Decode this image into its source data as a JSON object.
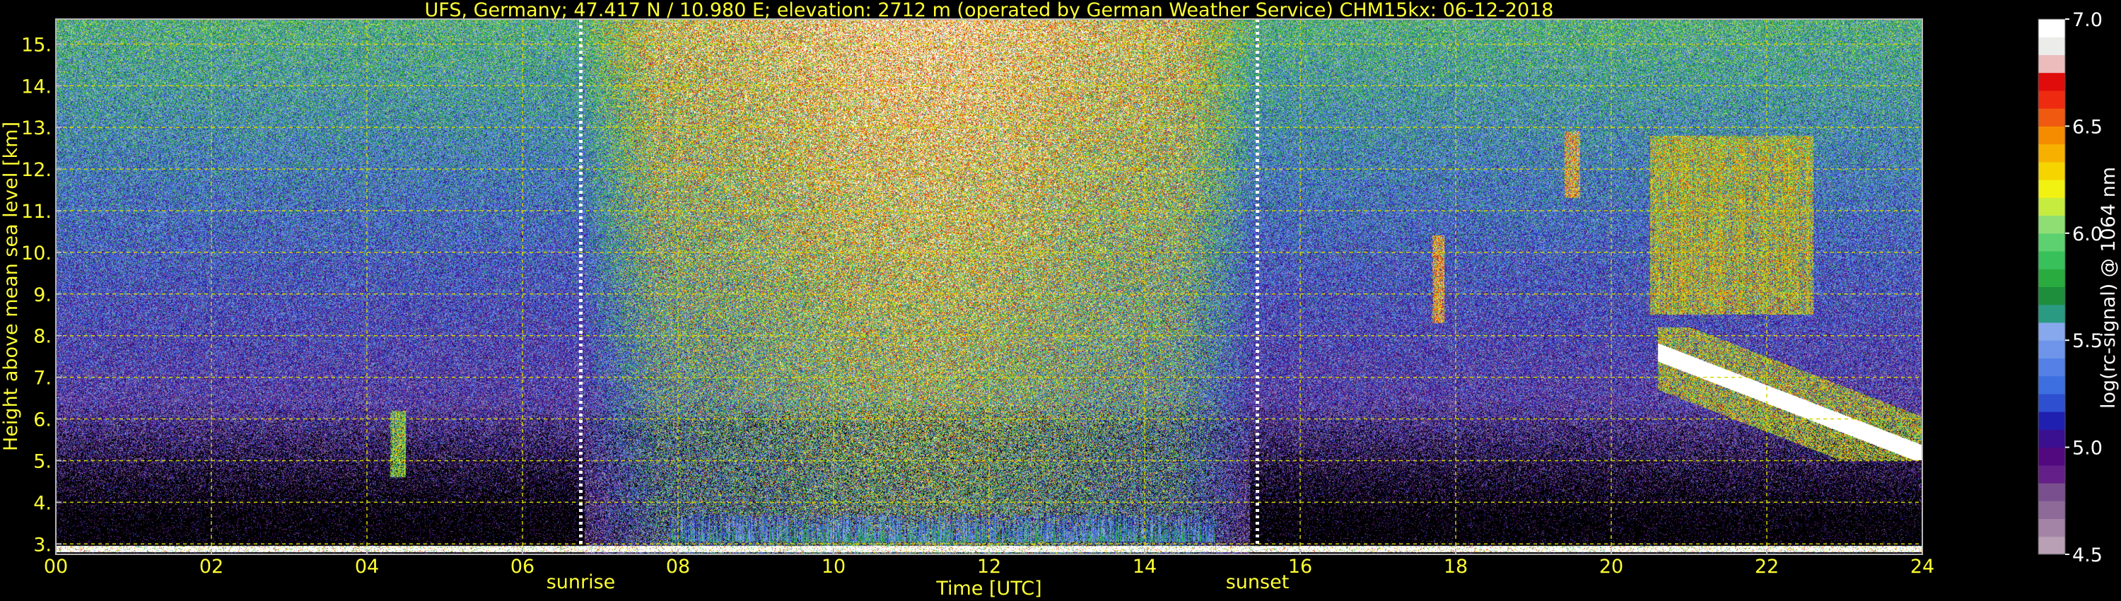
{
  "chart_data": {
    "type": "heatmap",
    "title": "UFS, Germany; 47.417 N / 10.980 E; elevation: 2712 m  (operated by German Weather Service)    CHM15kx: 06-12-2018",
    "xlabel": "Time [UTC]",
    "ylabel": "Height above mean sea level [km]",
    "xlim": [
      0,
      24
    ],
    "ylim": [
      2.75,
      15.6
    ],
    "x_ticks": [
      "00",
      "02",
      "04",
      "06",
      "08",
      "10",
      "12",
      "14",
      "16",
      "18",
      "20",
      "22",
      "24"
    ],
    "x_tick_values": [
      0,
      2,
      4,
      6,
      8,
      10,
      12,
      14,
      16,
      18,
      20,
      22,
      24
    ],
    "y_ticks": [
      "3.",
      "4.",
      "5.",
      "6.",
      "7.",
      "8.",
      "9.",
      "10.",
      "11.",
      "12.",
      "13.",
      "14.",
      "15."
    ],
    "y_tick_values": [
      3,
      4,
      5,
      6,
      7,
      8,
      9,
      10,
      11,
      12,
      13,
      14,
      15
    ],
    "grid": true,
    "grid_color": "#d4d400",
    "label_color": "#ffff33",
    "sun_events": [
      {
        "label": "sunrise",
        "time": 6.75
      },
      {
        "label": "sunset",
        "time": 15.45
      }
    ],
    "colorbar": {
      "label": "log(rc-signal) @ 1064 nm",
      "min": 4.5,
      "max": 7.0,
      "ticks": [
        "4.5",
        "5.0",
        "5.5",
        "6.0",
        "6.5",
        "7.0"
      ],
      "tick_values": [
        4.5,
        5.0,
        5.5,
        6.0,
        6.5,
        7.0
      ],
      "colors": [
        "#b9a0b4",
        "#a383a6",
        "#8e6a99",
        "#7a4f8e",
        "#651f88",
        "#52087e",
        "#3a0f90",
        "#2020b0",
        "#2d4fd0",
        "#3e6fe0",
        "#5580e6",
        "#6f95ea",
        "#87a8ec",
        "#2a9a82",
        "#1e8d3c",
        "#2aab40",
        "#38c05a",
        "#5dd070",
        "#8fde74",
        "#c6ec40",
        "#f2f212",
        "#f5d400",
        "#f7b000",
        "#f58c00",
        "#f05a10",
        "#ee2a10",
        "#e00b0b",
        "#ecbcbc",
        "#ececea",
        "#ffffff"
      ]
    },
    "features": [
      {
        "description": "surface layer",
        "t_start": 0,
        "t_end": 24,
        "z_bottom": 2.8,
        "z_top": 2.95,
        "level": 7.0
      },
      {
        "description": "boundary layer aerosol",
        "t_start": 7.9,
        "t_end": 14.9,
        "z_bottom": 3.05,
        "z_top": 3.7,
        "level": 5.2
      },
      {
        "description": "morning cloud",
        "t_start": 4.3,
        "t_end": 4.5,
        "z_bottom": 4.6,
        "z_top": 6.2,
        "level": 6.0
      },
      {
        "description": "cirrus",
        "t_start": 17.7,
        "t_end": 17.85,
        "z_bottom": 8.3,
        "z_top": 10.4,
        "level": 6.4
      },
      {
        "description": "cirrus",
        "t_start": 19.4,
        "t_end": 19.6,
        "z_bottom": 11.3,
        "z_top": 12.9,
        "level": 6.4
      },
      {
        "description": "cirrus",
        "t_start": 20.5,
        "t_end": 22.6,
        "z_bottom": 8.5,
        "z_top": 12.8,
        "level": 6.2
      },
      {
        "description": "mid-level cloud",
        "t_start": 20.6,
        "t_end": 24,
        "z_bottom": 5.0,
        "z_top": 8.2,
        "level": 6.8
      }
    ]
  }
}
